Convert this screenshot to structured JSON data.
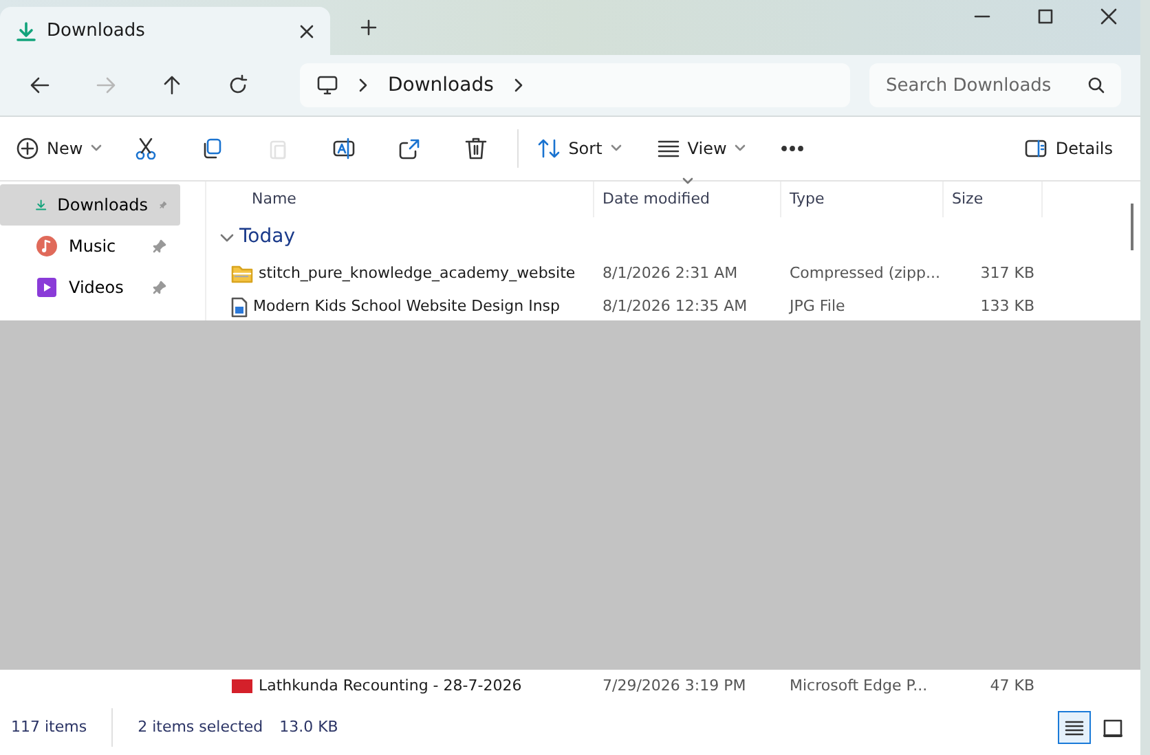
{
  "window": {
    "tab_title": "Downloads"
  },
  "nav_buttons": [
    {
      "disabled": false
    },
    {
      "disabled": true
    },
    {
      "disabled": false
    },
    {
      "disabled": false
    }
  ],
  "breadcrumb": [
    "Downloads"
  ],
  "search": {
    "placeholder": "Search Downloads"
  },
  "toolbar": [
    {
      "kind": "menu",
      "label": "New",
      "disabled": false
    },
    {
      "kind": "icon",
      "disabled": false
    },
    {
      "kind": "icon",
      "disabled": false
    },
    {
      "kind": "icon",
      "disabled": true
    },
    {
      "kind": "icon",
      "disabled": false
    },
    {
      "kind": "icon",
      "disabled": false
    },
    {
      "kind": "icon",
      "disabled": false
    },
    {
      "kind": "menu",
      "label": "Sort",
      "disabled": false
    },
    {
      "kind": "menu",
      "label": "View",
      "disabled": false
    },
    {
      "kind": "more",
      "disabled": false
    }
  ],
  "details_button": {
    "label": "Details"
  },
  "sidebar": {
    "items": [
      {
        "label": "Downloads",
        "selected": true,
        "pinned": true
      },
      {
        "label": "Music",
        "selected": false,
        "pinned": true
      },
      {
        "label": "Videos",
        "selected": false,
        "pinned": true
      }
    ]
  },
  "table": {
    "columns": [
      {
        "label": "Name",
        "sorted": false
      },
      {
        "label": "Date modified",
        "sorted": true
      },
      {
        "label": "Type",
        "sorted": false
      },
      {
        "label": "Size",
        "sorted": false
      }
    ],
    "groups": [
      {
        "label": "Today",
        "expanded": true,
        "rows": [
          {
            "kind": "zip",
            "name": "stitch_pure_knowledge_academy_website",
            "date": "8/1/2026 2:31 AM",
            "type": "Compressed (zipp...",
            "size": "317 KB"
          },
          {
            "kind": "image",
            "name": "Modern Kids School Website Design Insp",
            "date": "8/1/2026 12:35 AM",
            "type": "JPG File",
            "size": "133 KB"
          }
        ]
      }
    ],
    "bottom_rows": [
      {
        "kind": "pdf",
        "name": "Lathkunda Recounting - 28-7-2026",
        "date": "7/29/2026 3:19 PM",
        "type": "Microsoft Edge P...",
        "size": "47 KB"
      }
    ]
  },
  "status_bar": {
    "items_count": "117 items",
    "selection": "2 items selected",
    "selection_size": "13.0 KB",
    "views": [
      {
        "selected": true
      },
      {
        "selected": false
      }
    ]
  }
}
